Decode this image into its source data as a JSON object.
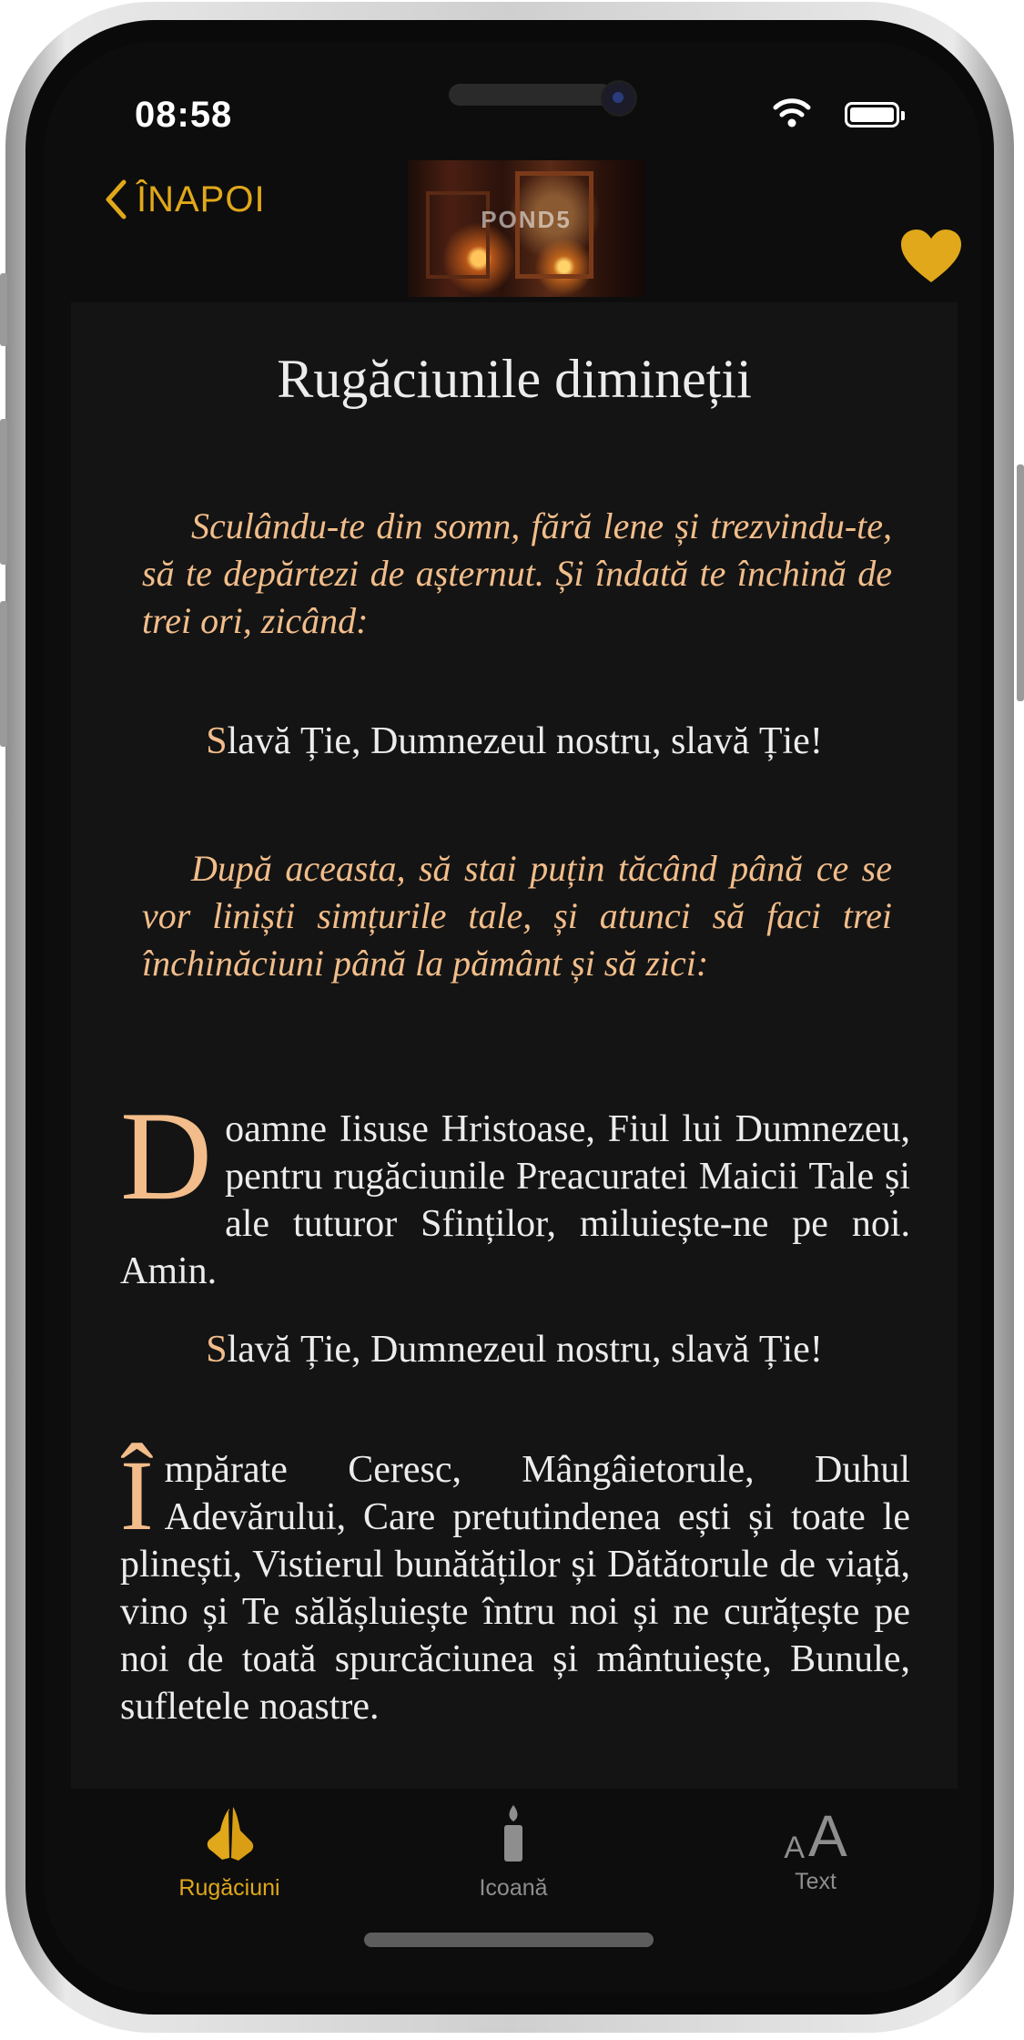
{
  "status_bar": {
    "time": "08:58"
  },
  "nav": {
    "back_label": "ÎNAPOI",
    "header_watermark": "POND5",
    "icons": {
      "back": "chevron-left-icon",
      "favorite": "heart-icon"
    }
  },
  "content": {
    "title": "Rugăciunile dimineții",
    "rubric_1": "Sculându-te din somn, fără lene și trezvindu-te, să te depărtezi de așternut. Și îndată te închină de trei ori, zicând:",
    "glory_1_cap": "S",
    "glory_1_rest": "lavă Ție, Dumnezeul nostru, slavă Ție!",
    "rubric_2": "După aceasta, să stai puțin tăcând până ce se vor liniști simțurile tale, și atunci să faci trei închinăciuni până la pământ și să zici:",
    "prayer_1_cap": "D",
    "prayer_1_rest": "oamne Iisuse Hristoase, Fiul lui Dumnezeu, pentru rugăciunile Preacuratei Maicii Tale și ale tuturor Sfinților, miluiește-ne pe noi. Amin.",
    "glory_2_cap": "S",
    "glory_2_rest": "lavă Ție, Dumnezeul nostru, slavă Ție!",
    "prayer_2_cap": "Î",
    "prayer_2_rest": "mpărate Ceresc, Mângâietorule, Duhul Adevărului, Care pretutindenea ești și toate le plinești, Vistierul bunătăților și Dătătorule de viață, vino și Te sălășluiește întru noi și ne curățește pe noi de toată spurcăciunea și mântuiește, Bunule, sufletele noastre."
  },
  "tabbar": {
    "items": [
      {
        "label": "Rugăciuni",
        "icon": "praying-hands-icon",
        "active": true
      },
      {
        "label": "Icoană",
        "icon": "candle-icon",
        "active": false
      },
      {
        "label": "Text",
        "icon": "text-size-icon",
        "glyph_small": "A",
        "glyph_large": "A",
        "active": false
      }
    ]
  },
  "colors": {
    "accent": "#e0a81a",
    "rubric": "#f2bd8a",
    "text": "#ececec",
    "background": "#0d0d0d",
    "page": "#141414",
    "tab_inactive": "#8e8e8e"
  }
}
